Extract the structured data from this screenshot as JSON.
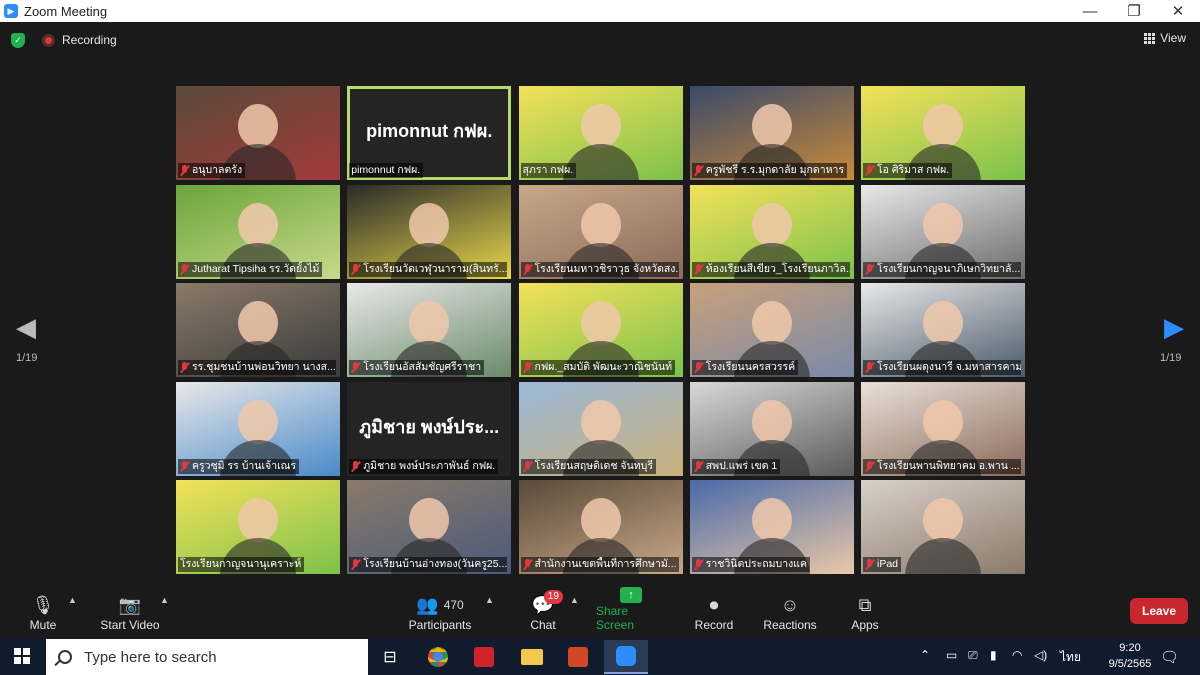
{
  "window": {
    "title": "Zoom Meeting",
    "minimize": "—",
    "maximize": "❐",
    "close": "✕"
  },
  "topbar": {
    "recording": "Recording",
    "view": "View"
  },
  "pager": {
    "left_page": "1/19",
    "right_page": "1/19"
  },
  "tiles": [
    {
      "name": "อนุบาลตรัง",
      "muted": true,
      "colors": [
        "#5a4a3a",
        "#a33a3a"
      ]
    },
    {
      "name": "pimonnut กฟผ.",
      "big": "pimonnut กฟผ.",
      "muted": false,
      "active": true
    },
    {
      "name": "สุภรา กฟผ.",
      "muted": false,
      "colors": [
        "#f3e15a",
        "#7cc24a"
      ]
    },
    {
      "name": "ครูพัชรี ร.ร.มุกดาลัย มุกดาหาร",
      "muted": true,
      "colors": [
        "#3a4a6a",
        "#c98a3a"
      ]
    },
    {
      "name": "โอ ศิริมาส กฟผ.",
      "muted": true,
      "colors": [
        "#f3e15a",
        "#7cc24a"
      ]
    },
    {
      "name": "Jutharat Tipsiha รร.วัดยั้งไม้",
      "muted": true,
      "colors": [
        "#6aa53a",
        "#c9d98a"
      ]
    },
    {
      "name": "โรงเรียนวัดเวฬุวนาราม(สินทรั...",
      "muted": true,
      "colors": [
        "#2a2a2a",
        "#e8d84a"
      ]
    },
    {
      "name": "โรงเรียนมหาวชิราวุธ จังหวัดสง...",
      "muted": true,
      "colors": [
        "#c8a888",
        "#8a6a5a"
      ]
    },
    {
      "name": "ห้องเรียนสีเขียว_โรงเรียนภาวิล...",
      "muted": true,
      "colors": [
        "#f3e15a",
        "#7cc24a"
      ]
    },
    {
      "name": "โรงเรียนกาญจนาภิเษกวิทยาลั...",
      "muted": true,
      "colors": [
        "#e8e8e8",
        "#6a6a6a"
      ]
    },
    {
      "name": "รร.ชุมชนบ้านพ่อนวิทยา นางส...",
      "muted": true,
      "colors": [
        "#8a7a6a",
        "#3a3a3a"
      ]
    },
    {
      "name": "โรงเรียนอัสสัมชัญศรีราชา",
      "muted": true,
      "colors": [
        "#e8e8e8",
        "#6a8a6a"
      ]
    },
    {
      "name": "กฟผ._สมบัติ พัฒนะวาณิชนันท์",
      "muted": true,
      "colors": [
        "#f3e15a",
        "#7cc24a"
      ]
    },
    {
      "name": "โรงเรียนนครสวรรค์",
      "muted": true,
      "colors": [
        "#c8a07a",
        "#7a8aa8"
      ]
    },
    {
      "name": "โรงเรียนผดุงนารี จ.มหาสารคาม",
      "muted": true,
      "colors": [
        "#e8e8e8",
        "#4a5a6a"
      ]
    },
    {
      "name": "ครูวชุมิ รร บ้านเจ้าเณร",
      "muted": true,
      "colors": [
        "#e8e8e8",
        "#4a8ac8"
      ]
    },
    {
      "name": "ภูมิชาย พงษ์ประภาพันธ์ กฟผ.",
      "big": "ภูมิชาย พงษ์ประ...",
      "muted": true
    },
    {
      "name": "โรงเรียนสฤษดิเดช จันทบุรี",
      "muted": true,
      "colors": [
        "#9ab8d8",
        "#c8b07a"
      ]
    },
    {
      "name": "สพป.แพร่ เขต 1",
      "muted": true,
      "colors": [
        "#d8d8d8",
        "#5a5a5a"
      ]
    },
    {
      "name": "โรงเรียนพานพิทยาคม อ.พาน ...",
      "muted": true,
      "colors": [
        "#e8e0d8",
        "#8a6a5a"
      ]
    },
    {
      "name": "โรงเรียนกาญจนานุเคราะห์",
      "muted": false,
      "colors": [
        "#f3e15a",
        "#7cc24a"
      ]
    },
    {
      "name": "โรงเรียนบ้านอ่างทอง(วันครู25...",
      "muted": true,
      "colors": [
        "#8a7a6a",
        "#4a5a7a"
      ]
    },
    {
      "name": "สำนักงานเขตพื้นที่การศึกษามั...",
      "muted": true,
      "colors": [
        "#5a4a3a",
        "#c8a888"
      ]
    },
    {
      "name": "ราชวินิตประถมบางแค",
      "muted": true,
      "colors": [
        "#4a6aa8",
        "#e8c8a8"
      ]
    },
    {
      "name": "iPad",
      "muted": true,
      "colors": [
        "#d8d0c8",
        "#8a7a6a"
      ]
    }
  ],
  "toolbar": {
    "mute": "Mute",
    "start_video": "Start Video",
    "participants": "Participants",
    "participants_count": "470",
    "chat": "Chat",
    "chat_badge": "19",
    "share_screen": "Share Screen",
    "record": "Record",
    "reactions": "Reactions",
    "apps": "Apps",
    "leave": "Leave"
  },
  "taskbar": {
    "search_placeholder": "Type here to search",
    "language": "ไทย",
    "time": "9:20",
    "date": "9/5/2565"
  },
  "colors": {
    "accent_green": "#23b14d",
    "leave_red": "#c8272d",
    "active_border": "#b6d96a",
    "zoom_blue": "#2d8cff"
  }
}
